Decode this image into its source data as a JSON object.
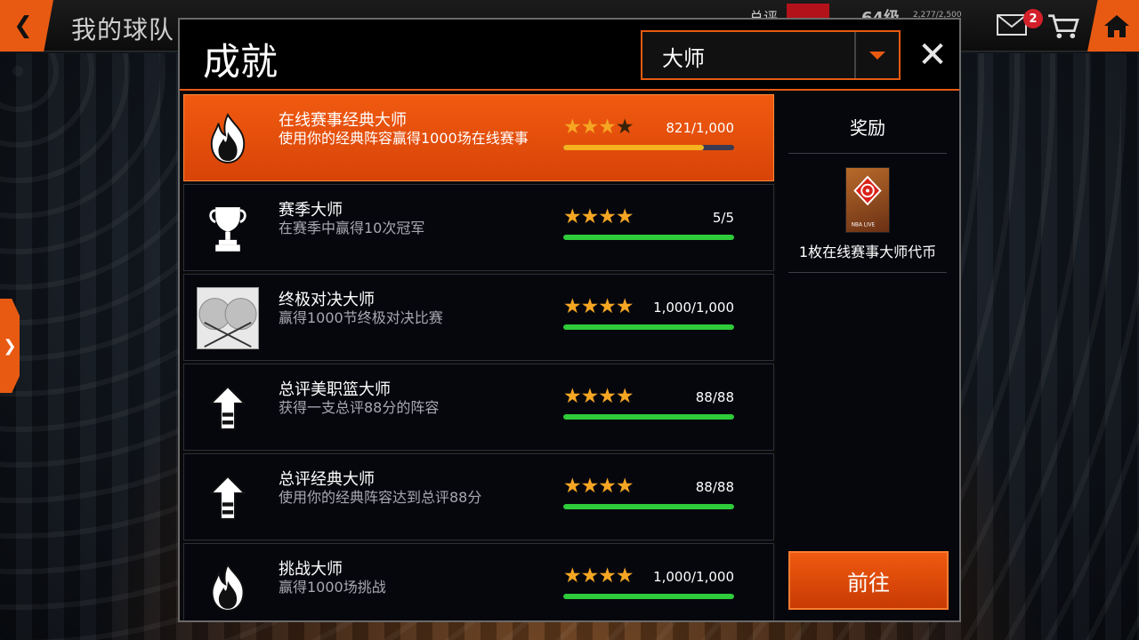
{
  "topbar": {
    "team_title": "我的球队",
    "rating_label": "总评",
    "level": "64级",
    "xp": "2,277/2,500",
    "mail_badge": "2"
  },
  "modal": {
    "title": "成就",
    "filter_value": "大师",
    "close_label": "✕"
  },
  "achievements": [
    {
      "title": "在线赛事经典大师",
      "desc": "使用你的经典阵容赢得1000场在线赛事",
      "stars_filled": 3,
      "stars_total": 4,
      "progress_text": "821/1,000",
      "progress_fraction": 0.821,
      "icon": "flame-icon",
      "selected": true
    },
    {
      "title": "赛季大师",
      "desc": "在赛季中赢得10次冠军",
      "stars_filled": 4,
      "stars_total": 4,
      "progress_text": "5/5",
      "progress_fraction": 1.0,
      "icon": "trophy-icon",
      "selected": false
    },
    {
      "title": "终极对决大师",
      "desc": "赢得1000节终极对决比赛",
      "stars_filled": 4,
      "stars_total": 4,
      "progress_text": "1,000/1,000",
      "progress_fraction": 1.0,
      "icon": "head-to-head-icon",
      "selected": false
    },
    {
      "title": "总评美职篮大师",
      "desc": "获得一支总评88分的阵容",
      "stars_filled": 4,
      "stars_total": 4,
      "progress_text": "88/88",
      "progress_fraction": 1.0,
      "icon": "upgrade-arrow-icon",
      "selected": false
    },
    {
      "title": "总评经典大师",
      "desc": "使用你的经典阵容达到总评88分",
      "stars_filled": 4,
      "stars_total": 4,
      "progress_text": "88/88",
      "progress_fraction": 1.0,
      "icon": "upgrade-arrow-icon",
      "selected": false
    },
    {
      "title": "挑战大师",
      "desc": "赢得1000场挑战",
      "stars_filled": 4,
      "stars_total": 4,
      "progress_text": "1,000/1,000",
      "progress_fraction": 1.0,
      "icon": "flame-icon",
      "selected": false
    }
  ],
  "reward": {
    "title": "奖励",
    "name": "1枚在线赛事大师代币",
    "card_brand": "NBA LIVE",
    "go_label": "前往"
  },
  "colors": {
    "accent": "#e85a12",
    "star": "#f5a623",
    "progress_complete": "#2ecc3a",
    "progress_partial": "#f5b320"
  }
}
